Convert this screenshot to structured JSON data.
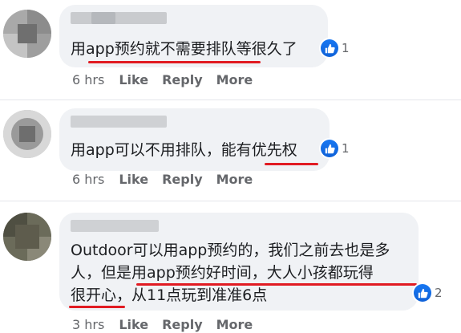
{
  "comments": [
    {
      "text": "用app预约就不需要排队等很久了",
      "reaction_count": "1",
      "time": "6 hrs",
      "like_label": "Like",
      "reply_label": "Reply",
      "more_label": "More"
    },
    {
      "text": "用app可以不用排队，能有优先权",
      "reaction_count": "1",
      "time": "6 hrs",
      "like_label": "Like",
      "reply_label": "Reply",
      "more_label": "More"
    },
    {
      "lines": [
        "Outdoor可以用app预约的，我们之前去也是多",
        "人，但是用app预约好时间，大人小孩都玩得",
        "很开心，从11点玩到准准6点"
      ],
      "reaction_count": "2",
      "time": "3 hrs",
      "like_label": "Like",
      "reply_label": "Reply",
      "more_label": "More"
    }
  ],
  "colors": {
    "bubble": "#f0f2f5",
    "like_blue": "#1877f2",
    "underline_red": "#e11b22",
    "meta_gray": "#65676b"
  },
  "icons": {
    "reaction": "like-thumbs-up-icon"
  }
}
